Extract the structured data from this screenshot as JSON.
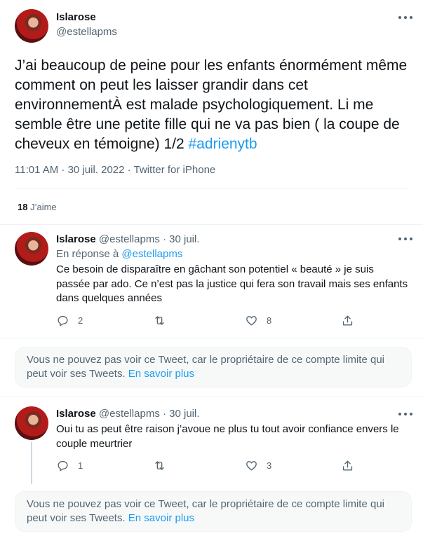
{
  "main_tweet": {
    "display_name": "Islarose",
    "handle": "@estellapms",
    "text": "J’ai beaucoup de peine pour les enfants énormément même comment on peut les laisser grandir dans cet environnementÀ est malade psychologiquement. Li me semble être une petite fille qui ne va pas bien ( la coupe de cheveux en témoigne)  1/2 ",
    "hashtag": "#adrienytb",
    "timestamp": "11:01 AM · 30 juil. 2022 · Twitter for iPhone",
    "likes_count": "18",
    "likes_label": "J’aime"
  },
  "replies": [
    {
      "display_name": "Islarose",
      "handle_date": "@estellapms · 30 juil.",
      "reply_to_label": "En réponse à ",
      "reply_to_handle": "@estellapms",
      "text": "Ce besoin de disparaître en gâchant son potentiel « beauté » je suis passée par ado. Ce n’est pas la justice qui fera son travail mais ses enfants dans quelques années",
      "reply_count": "2",
      "retweet_count": "",
      "like_count": "8"
    },
    {
      "display_name": "Islarose",
      "handle_date": "@estellapms · 30 juil.",
      "text": "Oui tu as peut être raison j’avoue ne plus tu tout avoir confiance envers le couple meurtrier",
      "reply_count": "1",
      "retweet_count": "",
      "like_count": "3"
    }
  ],
  "notices": [
    {
      "text": "Vous ne pouvez pas voir ce Tweet, car le propriétaire de ce compte limite qui peut voir ses Tweets. ",
      "link": "En savoir plus"
    },
    {
      "text": "Vous ne pouvez pas voir ce Tweet, car le propriétaire de ce compte limite qui peut voir ses Tweets. ",
      "link": "En savoir plus"
    }
  ],
  "colors": {
    "accent": "#1d9bf0",
    "muted": "#536471",
    "text": "#0f1419"
  }
}
